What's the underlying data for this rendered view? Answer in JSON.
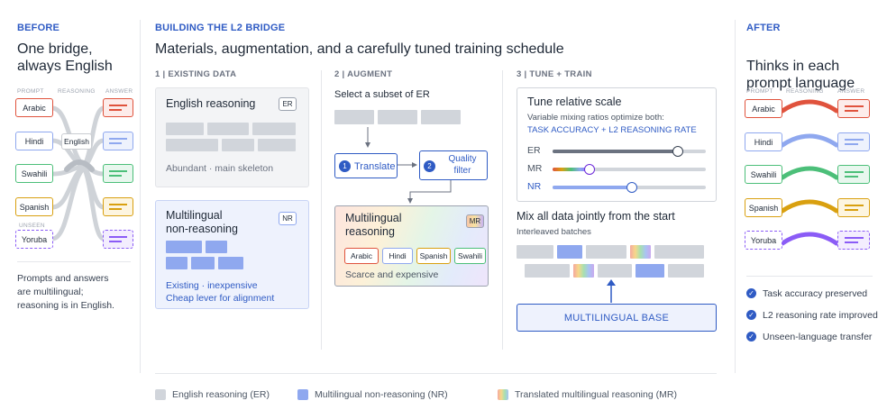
{
  "before": {
    "kicker": "BEFORE",
    "title_line1": "One bridge,",
    "title_line2": "always English",
    "col_prompt": "PROMPT",
    "col_reasoning": "REASONING",
    "col_answer": "ANSWER",
    "langs": [
      "Arabic",
      "Hindi",
      "Swahili",
      "Spanish",
      "Yoruba"
    ],
    "unseen": "UNSEEN",
    "bridge_label": "English",
    "desc_lines": [
      "Prompts and answers",
      "are multilingual;",
      "reasoning is in English."
    ]
  },
  "middle": {
    "kicker": "BUILDING THE L2 BRIDGE",
    "title": "Materials, augmentation, and a carefully tuned training schedule",
    "s1": {
      "title": "1 | EXISTING DATA",
      "er_title": "English reasoning",
      "er_badge": "ER",
      "er_caption": "Abundant · main skeleton",
      "nr_title_line1": "Multilingual",
      "nr_title_line2": "non-reasoning",
      "nr_badge": "NR",
      "nr_caption1": "Existing · inexpensive",
      "nr_caption2": "Cheap lever for alignment"
    },
    "s2": {
      "title": "2 | AUGMENT",
      "select": "Select a subset of ER",
      "step1_num": "1",
      "step1": "Translate",
      "step2_num": "2",
      "step2_line1": "Quality",
      "step2_line2": "filter",
      "mr_title_line1": "Multilingual",
      "mr_title_line2": "reasoning",
      "mr_badge": "MR",
      "mr_langs": [
        "Arabic",
        "Hindi",
        "Spanish",
        "Swahili"
      ],
      "mr_caption": "Scarce and expensive"
    },
    "s3": {
      "title": "3 | TUNE + TRAIN",
      "tune_title": "Tune relative scale",
      "tune_sub": "Variable mixing ratios optimize both:",
      "tune_target": "TASK ACCURACY + L2 REASONING RATE",
      "sliders": [
        {
          "label": "ER",
          "value": 0.82
        },
        {
          "label": "MR",
          "value": 0.24
        },
        {
          "label": "NR",
          "value": 0.52
        }
      ],
      "mix_title": "Mix all data jointly from the start",
      "mix_sub": "Interleaved batches",
      "base": "MULTILINGUAL BASE"
    }
  },
  "after": {
    "kicker": "AFTER",
    "title_line1": "Thinks in each",
    "title_line2": "prompt language",
    "col_prompt": "PROMPT",
    "col_reasoning": "REASONING",
    "col_answer": "ANSWER",
    "langs": [
      "Arabic",
      "Hindi",
      "Swahili",
      "Spanish",
      "Yoruba"
    ],
    "results": [
      "Task accuracy preserved",
      "L2 reasoning rate improved",
      "Unseen-language transfer"
    ]
  },
  "legend": {
    "er": "English reasoning (ER)",
    "nr": "Multilingual non-reasoning (NR)",
    "mr": "Translated multilingual reasoning (MR)"
  },
  "colors": {
    "accent": "#2f5bc4",
    "arabic": "#e0533d",
    "hindi": "#8fa8ef",
    "swahili": "#4cbf79",
    "spanish": "#d9a010",
    "yoruba": "#8b5cf6",
    "er_gray": "#d1d5db",
    "nr_blue": "#8fa8ef"
  }
}
